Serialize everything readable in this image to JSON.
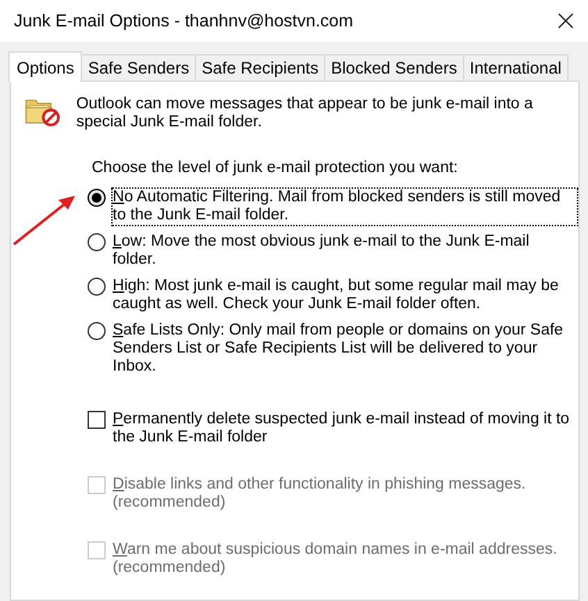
{
  "window": {
    "title": "Junk E-mail Options - thanhnv@hostvn.com"
  },
  "tabs": [
    {
      "label": "Options",
      "selected": true
    },
    {
      "label": "Safe Senders",
      "selected": false
    },
    {
      "label": "Safe Recipients",
      "selected": false
    },
    {
      "label": "Blocked Senders",
      "selected": false
    },
    {
      "label": "International",
      "selected": false
    }
  ],
  "intro": "Outlook can move messages that appear to be junk e-mail into a special Junk E-mail folder.",
  "prompt": "Choose the level of junk e-mail protection you want:",
  "levels": [
    {
      "label": "No Automatic Filtering. Mail from blocked senders is still moved to the Junk E-mail folder.",
      "selected": true
    },
    {
      "label": "Low: Move the most obvious junk e-mail to the Junk E-mail folder.",
      "selected": false
    },
    {
      "label": "High: Most junk e-mail is caught, but some regular mail may be caught as well. Check your Junk E-mail folder often.",
      "selected": false
    },
    {
      "label": "Safe Lists Only: Only mail from people or domains on your Safe Senders List or Safe Recipients List will be delivered to your Inbox.",
      "selected": false
    }
  ],
  "options": [
    {
      "label": "Permanently delete suspected junk e-mail instead of moving it to the Junk E-mail folder",
      "checked": false,
      "disabled": false
    },
    {
      "label": "Disable links and other functionality in phishing messages. (recommended)",
      "checked": false,
      "disabled": true
    },
    {
      "label": "Warn me about suspicious domain names in e-mail addresses. (recommended)",
      "checked": false,
      "disabled": true
    }
  ]
}
